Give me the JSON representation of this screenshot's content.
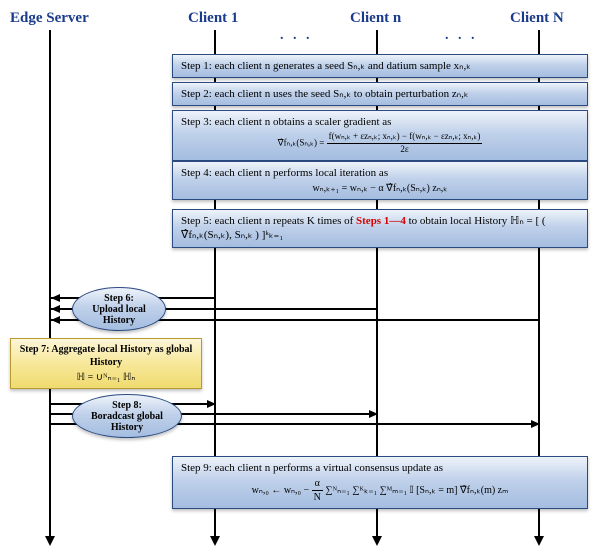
{
  "headers": {
    "edge": "Edge Server",
    "client1": "Client 1",
    "clientn": "Client n",
    "clientN": "Client N"
  },
  "dots": ". . .",
  "steps": {
    "s1": "Step 1: each client n generates a seed Sₙ,ₖ and datium sample xₙ,ₖ",
    "s2": "Step 2: each client n uses the seed Sₙ,ₖ to obtain perturbation zₙ,ₖ",
    "s3_label": "Step 3: each client n obtains a scaler gradient as",
    "s3_math_lhs": "∇̂fₙ,ₖ(Sₙ,ₖ) = ",
    "s3_math_num": "f(wₙ,ₖ + εzₙ,ₖ; xₙ,ₖ) − f(wₙ,ₖ − εzₙ,ₖ; xₙ,ₖ)",
    "s3_math_den": "2ε",
    "s4_label": "Step 4: each client n performs local iteration as",
    "s4_math": "wₙ,ₖ₊₁ = wₙ,ₖ − α ∇̂fₙ,ₖ(Sₙ,ₖ) zₙ,ₖ",
    "s5_a": "Step 5: each client n repeats K times of ",
    "s5_red": "Steps 1—4",
    "s5_b": " to obtain local History",
    "s5_math": " ℍₙ = [ ( ∇̂fₙ,ₖ(Sₙ,ₖ), Sₙ,ₖ ) ]ᵏₖ₌₁",
    "s9_label": "Step 9: each client n performs a virtual consensus update as",
    "s9_math_lhs": "wₙ,₀ ← wₙ,₀ − ",
    "s9_math_frac_num": "α",
    "s9_math_frac_den": "N",
    "s9_math_rhs": " ∑ᴺₙ₌₁ ∑ᴷₖ₌₁ ∑ᴹₘ₌₁ 𝕀 [Sₙ,ₖ = m] ∇̂fₙ,ₖ(m) zₘ"
  },
  "ovals": {
    "step6": "Step 6:\nUpload local\nHistory",
    "step8": "Step 8:\nBoradcast global\nHistory"
  },
  "yellow": {
    "step7_a": "Step 7: Aggregate local History as global History ",
    "step7_math": "ℍ = ∪ᴺₙ₌₁ ℍₙ"
  }
}
